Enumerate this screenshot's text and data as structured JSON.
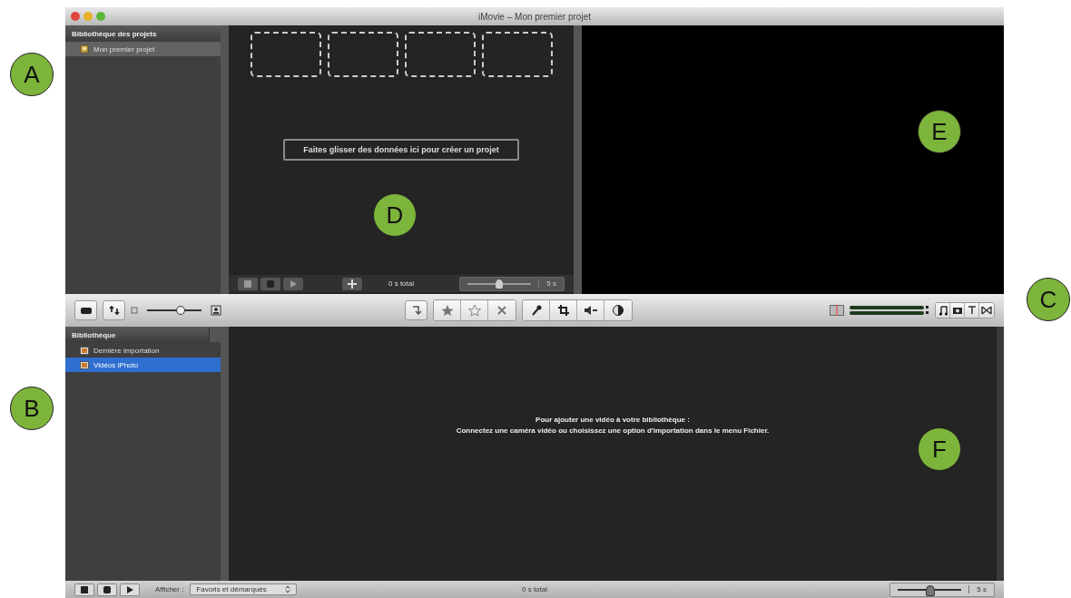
{
  "window": {
    "title": "iMovie – Mon premier projet"
  },
  "project_library": {
    "header": "Bibliothèque des projets",
    "items": [
      {
        "label": "Mon premier projet",
        "selected": true
      }
    ]
  },
  "project_area": {
    "drop_hint": "Faites glisser des données ici pour créer un projet"
  },
  "project_footer": {
    "total": "0 s total",
    "zoom": {
      "level": 0.5,
      "reading": "5 s"
    }
  },
  "toolbar": {
    "thumb_slider": {
      "level": 0.6
    }
  },
  "event_library": {
    "header": "Bibliothèque",
    "items": [
      {
        "label": "Dernière importation",
        "selected": false
      },
      {
        "label": "Vidéos iPhoto",
        "selected": true
      }
    ]
  },
  "event_area": {
    "message": "Pour ajouter une vidéo à votre bibliothèque :",
    "instruction": "Connectez une caméra vidéo ou choisissez une option d'importation dans le menu Fichier."
  },
  "event_footer": {
    "show_label": "Afficher :",
    "filter": "Favoris et démarqués",
    "total": "0 s total",
    "zoom": {
      "level": 0.5,
      "reading": "5 s"
    }
  },
  "callouts": [
    {
      "label": "A"
    },
    {
      "label": "B"
    },
    {
      "label": "C"
    },
    {
      "label": "D"
    },
    {
      "label": "E"
    },
    {
      "label": "F"
    }
  ]
}
